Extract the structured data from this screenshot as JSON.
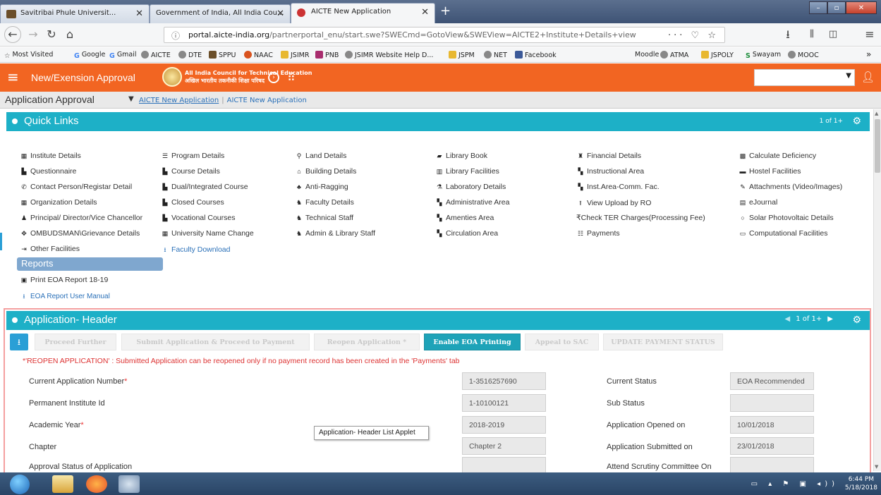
{
  "browser": {
    "tabs": [
      {
        "label": "Savitribai Phule Universit..."
      },
      {
        "label": "Government of India, All India Cou..."
      },
      {
        "label": "AICTE New Application"
      }
    ],
    "url_host": "portal.aicte-india.org",
    "url_path": "/partnerportal_enu/start.swe?SWECmd=GotoView&SWEView=AICTE2+Institute+Details+view",
    "url_tail": "··· ♡ ☆",
    "bookmarks": [
      "Most Visited",
      "Google",
      "Gmail",
      "AICTE",
      "DTE",
      "SPPU",
      "NAAC",
      "JSIMR",
      "PNB",
      "JSIMR Website Help D...",
      "JSPM",
      "NET",
      "Facebook",
      "Moodle",
      "ATMA",
      "JSPOLY",
      "Swayam",
      "MOOC"
    ]
  },
  "header": {
    "app_title": "New/Exension Approval",
    "council_en": "All India Council for Technical Education",
    "council_hi": "अखिल भारतीय तकनीकी शिक्षा परिषद"
  },
  "breadcrumb": {
    "screen": "Application Approval",
    "link1": "AICTE New Application",
    "link2": "AICTE New Application"
  },
  "quick_links": {
    "title": "Quick Links",
    "pager": "1 of 1+",
    "col1": [
      "Institute Details",
      "Questionnaire",
      "Contact Person/Registar Detail",
      "Organization Details",
      "Principal/ Director/Vice Chancellor",
      "OMBUDSMAN\\Grievance Details",
      "Other Facilities"
    ],
    "col2": [
      "Program Details",
      "Course Details",
      "Dual/Integrated Course",
      "Closed Courses",
      "Vocational Courses",
      "University Name Change",
      "Faculty Download"
    ],
    "col3": [
      "Land Details",
      "Building Details",
      "Anti-Ragging",
      "Faculty Details",
      "Technical Staff",
      "Admin & Library Staff"
    ],
    "col4": [
      "Library Book",
      "Library Facilities",
      "Laboratory Details",
      "Administrative Area",
      "Amenties Area",
      "Circulation Area"
    ],
    "col5": [
      "Financial Details",
      "Instructional Area",
      "Inst.Area-Comm. Fac.",
      "View Upload by RO",
      "₹Check TER Charges(Processing Fee)",
      "Payments"
    ],
    "col6": [
      "Calculate Deficiency",
      "Hostel Facilities",
      "Attachments (Video/Images)",
      "eJournal",
      "Solar Photovoltaic Details",
      "Computational Facilities"
    ],
    "reports_label": "Reports",
    "report_print": "Print EOA Report 18-19",
    "report_manual": "EOA Report User Manual"
  },
  "app_header": {
    "title": "Application- Header",
    "pager": "1 of 1+",
    "buttons": [
      "Proceed Further",
      "Submit Application & Proceed to Payment",
      "Reopen Application *",
      "Enable EOA Printing",
      "Appeal to SAC",
      "UPDATE PAYMENT STATUS"
    ],
    "warning": "*'REOPEN APPLICATION' : Submitted Application can be reopened only if no payment record has been created in the 'Payments' tab",
    "fields_left": [
      {
        "label": "Current Application Number",
        "required": "*",
        "value": "1-3516257690"
      },
      {
        "label": "Permanent Institute Id",
        "required": "",
        "value": "1-10100121"
      },
      {
        "label": "Academic Year",
        "required": "*",
        "value": "2018-2019"
      },
      {
        "label": "Chapter",
        "required": "",
        "value": "Chapter 2"
      },
      {
        "label": "Approval Status of Application",
        "required": "",
        "value": ""
      }
    ],
    "fields_right": [
      {
        "label": "Current Status",
        "value": "EOA Recommended"
      },
      {
        "label": "Sub Status",
        "value": ""
      },
      {
        "label": "Application Opened on",
        "value": "10/01/2018"
      },
      {
        "label": "Application Submitted on",
        "value": "23/01/2018"
      },
      {
        "label": "Attend Scrutiny Committee On",
        "value": ""
      }
    ],
    "tooltip": "Application- Header List Applet"
  },
  "taskbar": {
    "time": "6:44 PM",
    "date": "5/18/2018"
  }
}
